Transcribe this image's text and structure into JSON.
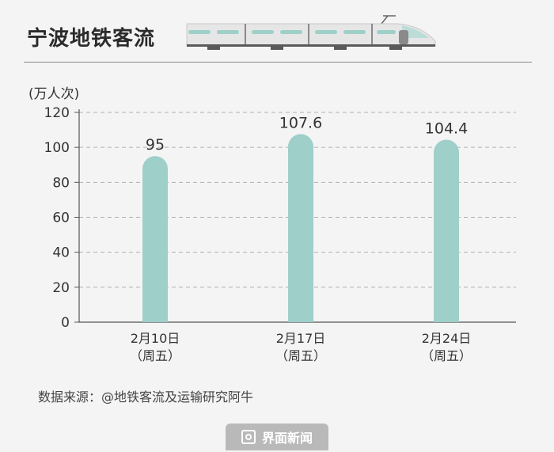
{
  "header": {
    "title": "宁波地铁客流",
    "train_icon": "train-icon"
  },
  "unit_label": "(万人次)",
  "source": "数据来源：@地铁客流及运输研究阿牛",
  "brand": {
    "label": "界面新闻",
    "icon": "brand-logo-icon"
  },
  "colors": {
    "bar": "#9ecfc9",
    "axis": "#555555",
    "grid": "#b0b0b0",
    "text": "#333333"
  },
  "chart_data": {
    "type": "bar",
    "title": "宁波地铁客流",
    "ylabel": "(万人次)",
    "ylim": [
      0,
      120
    ],
    "yticks": [
      0,
      20,
      40,
      60,
      80,
      100,
      120
    ],
    "grid": true,
    "categories": [
      "2月10日",
      "2月17日",
      "2月24日"
    ],
    "sublabels": [
      "（周五）",
      "（周五）",
      "（周五）"
    ],
    "values": [
      95,
      107.6,
      104.4
    ],
    "value_labels": [
      "95",
      "107.6",
      "104.4"
    ]
  }
}
